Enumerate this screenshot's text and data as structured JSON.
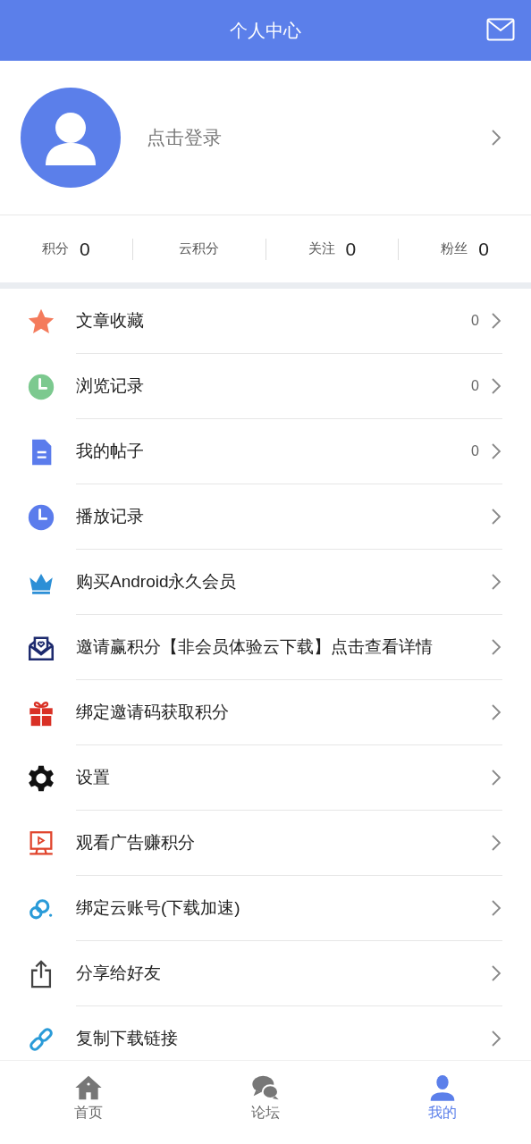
{
  "header": {
    "title": "个人中心"
  },
  "profile": {
    "login_prompt": "点击登录"
  },
  "stats": [
    {
      "label": "积分",
      "value": "0"
    },
    {
      "label": "云积分"
    },
    {
      "label": "关注",
      "value": "0"
    },
    {
      "label": "粉丝",
      "value": "0"
    }
  ],
  "menu": [
    {
      "kind": "star",
      "label": "文章收藏",
      "count": "0"
    },
    {
      "kind": "clock-green",
      "label": "浏览记录",
      "count": "0"
    },
    {
      "kind": "document",
      "label": "我的帖子",
      "count": "0"
    },
    {
      "kind": "clock-blue",
      "label": "播放记录"
    },
    {
      "kind": "crown",
      "label": "购买Android永久会员"
    },
    {
      "kind": "envelope-heart",
      "label": "邀请赢积分【非会员体验云下载】点击查看详情"
    },
    {
      "kind": "gift",
      "label": "绑定邀请码获取积分"
    },
    {
      "kind": "gear",
      "label": "设置"
    },
    {
      "kind": "screen-play",
      "label": "观看广告赚积分"
    },
    {
      "kind": "cloud-link",
      "label": "绑定云账号(下载加速)"
    },
    {
      "kind": "share",
      "label": "分享给好友"
    },
    {
      "kind": "chain",
      "label": "复制下载链接"
    }
  ],
  "tab_bar": [
    {
      "kind": "home",
      "label": "首页",
      "selected": false
    },
    {
      "kind": "chat",
      "label": "论坛",
      "selected": false
    },
    {
      "kind": "person",
      "label": "我的",
      "selected": true
    }
  ]
}
